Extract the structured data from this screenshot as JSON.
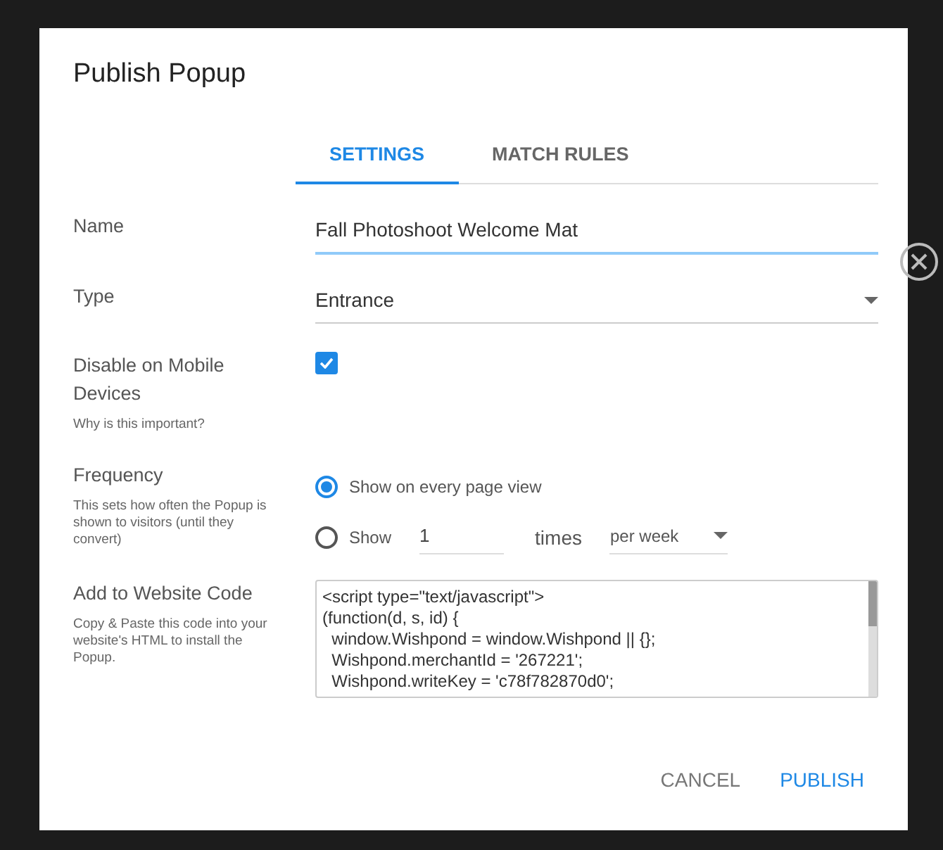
{
  "dialog": {
    "title": "Publish Popup"
  },
  "tabs": [
    {
      "label": "SETTINGS",
      "selected": true
    },
    {
      "label": "MATCH RULES",
      "selected": false
    }
  ],
  "name_field": {
    "label": "Name",
    "value": "Fall Photoshoot Welcome Mat"
  },
  "type_field": {
    "label": "Type",
    "value": "Entrance"
  },
  "mobile": {
    "label": "Disable on Mobile Devices",
    "help": "Why is this important?",
    "checked": true
  },
  "frequency": {
    "label": "Frequency",
    "description": "This sets how often the Popup is shown to visitors (until they convert)",
    "options": [
      {
        "kind": "plain",
        "label": "Show on every page view",
        "selected": true
      },
      {
        "kind": "count",
        "label": "Show",
        "count": "1",
        "unit": "times",
        "period": "per week",
        "selected": false
      }
    ]
  },
  "code": {
    "label": "Add to Website Code",
    "description": "Copy & Paste this code into your website's HTML to install the Popup.",
    "lines": [
      "<script type=\"text/javascript\">",
      "(function(d, s, id) {",
      "  window.Wishpond = window.Wishpond || {};",
      "  Wishpond.merchantId = '267221';",
      "  Wishpond.writeKey = 'c78f782870d0';"
    ]
  },
  "buttons": [
    {
      "kind": "secondary",
      "label": "CANCEL"
    },
    {
      "kind": "primary",
      "label": "PUBLISH"
    }
  ]
}
